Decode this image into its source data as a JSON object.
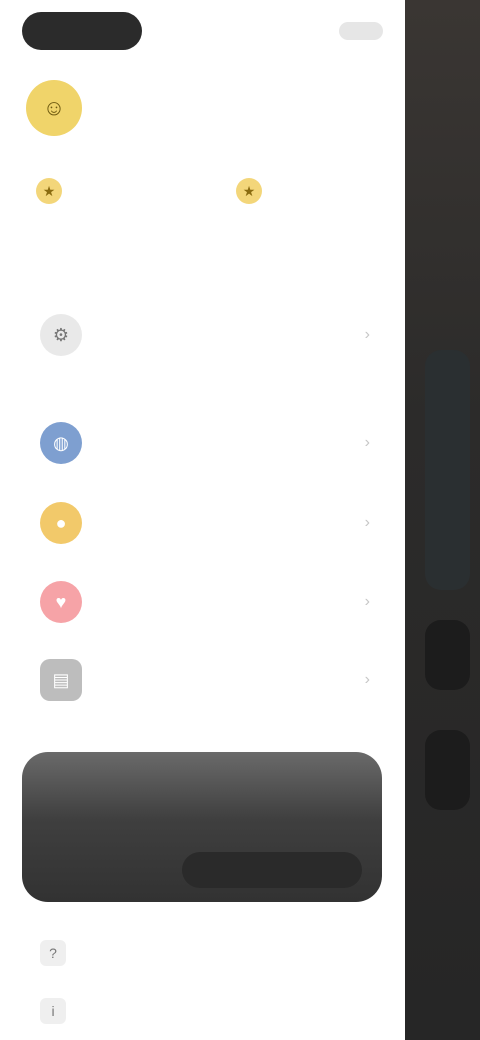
{
  "header": {
    "pill_text": "",
    "right_text": ""
  },
  "profile": {
    "name": ""
  },
  "stats": [
    {
      "label": "",
      "icon": "star-icon"
    },
    {
      "label": "",
      "icon": "star-icon"
    }
  ],
  "menu": [
    {
      "label": "",
      "icon": "settings-icon",
      "color": "#e9e9e9"
    },
    {
      "label": "",
      "icon": "globe-icon",
      "color": "#7e9fd0"
    },
    {
      "label": "",
      "icon": "coin-icon",
      "color": "#f2c96a"
    },
    {
      "label": "",
      "icon": "heart-icon",
      "color": "#f6a3a7"
    },
    {
      "label": "",
      "icon": "clipboard-icon",
      "color": "#bdbdbd"
    }
  ],
  "promo": {
    "title": "",
    "subtitle": "",
    "left_text": "",
    "button": ""
  },
  "bottom": [
    {
      "label": "",
      "icon": "help-icon"
    },
    {
      "label": "",
      "icon": "info-icon"
    }
  ]
}
